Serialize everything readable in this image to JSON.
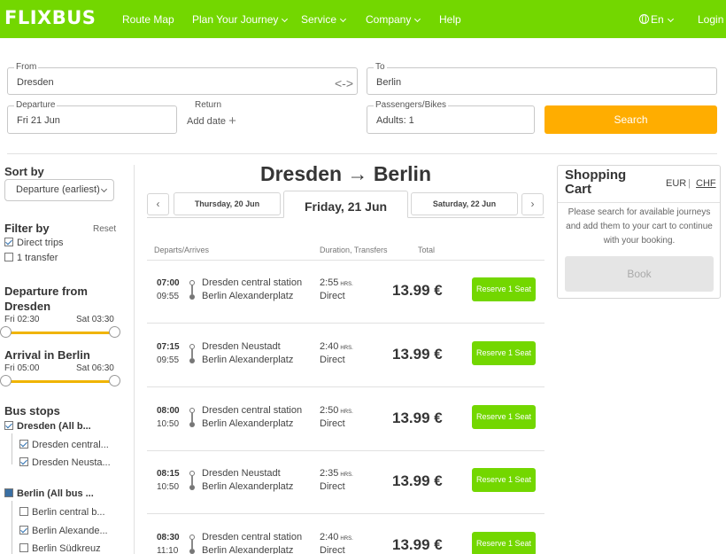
{
  "header": {
    "logo": "FLIXBUS",
    "nav": [
      {
        "label": "Route Map"
      },
      {
        "label": "Plan Your Journey"
      },
      {
        "label": "Service"
      },
      {
        "label": "Company"
      },
      {
        "label": "Help"
      }
    ],
    "language": "En",
    "login": "Login"
  },
  "search": {
    "from_label": "From",
    "from_value": "Dresden",
    "to_label": "To",
    "to_value": "Berlin",
    "departure_label": "Departure",
    "departure_value": "Fri 21 Jun",
    "return_label": "Return",
    "return_value": "Add date",
    "passengers_label": "Passengers/Bikes",
    "passengers_value": "Adults: 1",
    "search_button": "Search",
    "swap_glyph": "<->"
  },
  "sidebar": {
    "sort_title": "Sort by",
    "sort_value": "Departure (earliest)",
    "filter_title": "Filter by",
    "reset": "Reset",
    "filters": [
      {
        "label": "Direct trips",
        "checked": true
      },
      {
        "label": "1 transfer",
        "checked": false
      }
    ],
    "departure_title": "Departure from Dresden",
    "departure_title_l1": "Departure from",
    "departure_title_l2": "Dresden",
    "departure_min": "Fri 02:30",
    "departure_max": "Sat 03:30",
    "arrival_title": "Arrival in Berlin",
    "arrival_min": "Fri 05:00",
    "arrival_max": "Sat 06:30",
    "stops_title": "Bus stops",
    "stop_groups": [
      {
        "label": "Dresden (All b...",
        "state": "checked",
        "stops": [
          {
            "label": "Dresden central...",
            "checked": true
          },
          {
            "label": "Dresden Neusta...",
            "checked": true
          }
        ]
      },
      {
        "label": "Berlin (All bus ...",
        "state": "partial",
        "stops": [
          {
            "label": "Berlin central b...",
            "checked": false
          },
          {
            "label": "Berlin Alexande...",
            "checked": true
          },
          {
            "label": "Berlin Südkreuz",
            "checked": false
          }
        ]
      }
    ]
  },
  "main": {
    "route_title": "Dresden → Berlin",
    "prev_glyph": "‹",
    "next_glyph": "›",
    "days": [
      {
        "label": "Thursday, 20 Jun"
      },
      {
        "label": "Friday, 21 Jun",
        "active": true
      },
      {
        "label": "Saturday, 22 Jun"
      }
    ],
    "columns": {
      "departs": "Departs/Arrives",
      "duration": "Duration, Transfers",
      "total": "Total"
    },
    "hrs_label": "HRS.",
    "trips": [
      {
        "dep": "07:00",
        "arr": "09:55",
        "from": "Dresden central station",
        "to": "Berlin Alexanderplatz",
        "duration": "2:55",
        "transfers": "Direct",
        "price": "13.99 €",
        "button": "Reserve 1 Seat"
      },
      {
        "dep": "07:15",
        "arr": "09:55",
        "from": "Dresden Neustadt",
        "to": "Berlin Alexanderplatz",
        "duration": "2:40",
        "transfers": "Direct",
        "price": "13.99 €",
        "button": "Reserve 1 Seat"
      },
      {
        "dep": "08:00",
        "arr": "10:50",
        "from": "Dresden central station",
        "to": "Berlin Alexanderplatz",
        "duration": "2:50",
        "transfers": "Direct",
        "price": "13.99 €",
        "button": "Reserve 1 Seat"
      },
      {
        "dep": "08:15",
        "arr": "10:50",
        "from": "Dresden Neustadt",
        "to": "Berlin Alexanderplatz",
        "duration": "2:35",
        "transfers": "Direct",
        "price": "13.99 €",
        "button": "Reserve 1 Seat"
      },
      {
        "dep": "08:30",
        "arr": "11:10",
        "from": "Dresden central station",
        "to": "Berlin Alexanderplatz",
        "duration": "2:40",
        "transfers": "Direct",
        "price": "13.99 €",
        "button": "Reserve 1 Seat"
      }
    ]
  },
  "cart": {
    "title": "Shopping Cart",
    "currency_eur": "EUR",
    "currency_sep": "|",
    "currency_chf": "CHF",
    "message": "Please search for available journeys and add them to your cart to continue with your booking.",
    "book": "Book"
  },
  "colors": {
    "brand_green": "#73d700",
    "search_orange": "#ffad00",
    "slider_yellow": "#f0b400"
  }
}
